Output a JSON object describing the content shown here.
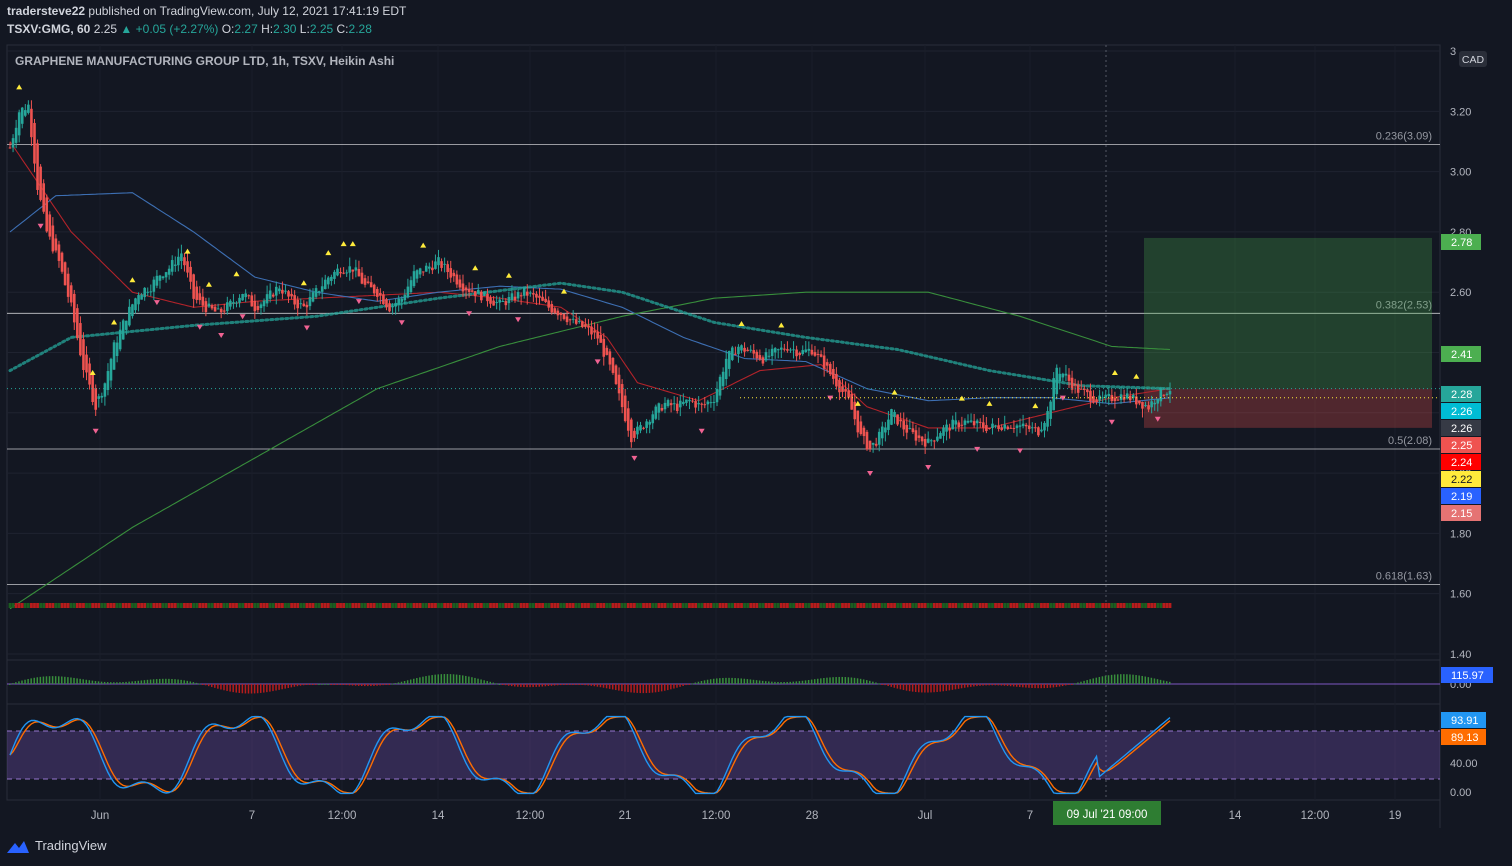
{
  "header": {
    "author": "tradersteve22",
    "published": "published on TradingView.com, July 12, 2021 17:41:19 EDT",
    "symbol": "TSXV:GMG, 60",
    "last": "2.25",
    "change": "+0.05 (+2.27%)",
    "open_label": "O:",
    "open": "2.27",
    "high_label": "H:",
    "high": "2.30",
    "low_label": "L:",
    "low": "2.25",
    "close_label": "C:",
    "close": "2.28"
  },
  "footer": {
    "brand": "TradingView"
  },
  "colors": {
    "bg": "#131722",
    "up": "#26a69a",
    "down": "#ef5350",
    "ema_red": "#b2232a",
    "ema_blue": "#2962ff",
    "ema_green": "#388e3c",
    "teal_dots": "#26a69a",
    "stoch_k": "#2196f3",
    "stoch_d": "#ff6d00",
    "stoch_band": "#7e57c2"
  },
  "chart_data": [
    {
      "type": "line",
      "title": "GRAPHENE MANUFACTURING GROUP LTD, 1h, TSXV, Heikin Ashi",
      "currency": "CAD",
      "y_ticks": [
        "3",
        "3.20",
        "3.00",
        "2.80",
        "2.60",
        "2.40",
        "2.20",
        "2.00",
        "1.80",
        "1.60",
        "1.40"
      ],
      "y_tick_values": [
        3.4,
        3.2,
        3.0,
        2.8,
        2.6,
        2.4,
        2.2,
        2.0,
        1.8,
        1.6,
        1.4
      ],
      "ylim": [
        1.38,
        3.42
      ],
      "x_ticks": [
        "Jun",
        "7",
        "12:00",
        "14",
        "12:00",
        "21",
        "12:00",
        "28",
        "Jul",
        "7",
        "14",
        "12:00",
        "19"
      ],
      "crosshair_label": "09 Jul '21  09:00",
      "fib_levels": [
        {
          "label": "0.236(3.09)",
          "value": 3.09
        },
        {
          "label": "0.382(2.53)",
          "value": 2.53
        },
        {
          "label": "0.5(2.08)",
          "value": 2.08
        },
        {
          "label": "0.618(1.63)",
          "value": 1.63
        }
      ],
      "position": {
        "entry": 2.28,
        "target": 2.78,
        "stop": 2.15
      },
      "price_labels": [
        {
          "text": "2.78",
          "value": 2.78,
          "color": "#4caf50"
        },
        {
          "text": "2.41",
          "value": 2.41,
          "color": "#4caf50"
        },
        {
          "text": "2.28",
          "value": 2.28,
          "color": "#26a69a"
        },
        {
          "text": "2.26",
          "value": 2.26,
          "color": "#00bcd4"
        },
        {
          "text": "2.26",
          "value": 2.26,
          "color": "#363a45"
        },
        {
          "text": "2.25",
          "value": 2.25,
          "color": "#ef5350"
        },
        {
          "text": "2.24",
          "value": 2.24,
          "color": "#ff0000"
        },
        {
          "text": "2.22",
          "value": 2.22,
          "color": "#ffeb3b"
        },
        {
          "text": "2.19",
          "value": 2.19,
          "color": "#2962ff"
        },
        {
          "text": "2.15",
          "value": 2.15,
          "color": "#e57373"
        }
      ],
      "price_keypoints": [
        [
          0,
          3.08
        ],
        [
          3,
          3.2
        ],
        [
          6,
          3.22
        ],
        [
          9,
          2.95
        ],
        [
          12,
          2.8
        ],
        [
          16,
          2.7
        ],
        [
          20,
          2.55
        ],
        [
          24,
          2.35
        ],
        [
          28,
          2.22
        ],
        [
          31,
          2.3
        ],
        [
          34,
          2.42
        ],
        [
          38,
          2.52
        ],
        [
          42,
          2.6
        ],
        [
          46,
          2.62
        ],
        [
          49,
          2.66
        ],
        [
          52,
          2.68
        ],
        [
          56,
          2.73
        ],
        [
          60,
          2.58
        ],
        [
          64,
          2.55
        ],
        [
          68,
          2.53
        ],
        [
          72,
          2.56
        ],
        [
          76,
          2.6
        ],
        [
          80,
          2.55
        ],
        [
          84,
          2.58
        ],
        [
          88,
          2.62
        ],
        [
          92,
          2.57
        ],
        [
          96,
          2.55
        ],
        [
          100,
          2.6
        ],
        [
          104,
          2.65
        ],
        [
          108,
          2.68
        ],
        [
          112,
          2.68
        ],
        [
          116,
          2.62
        ],
        [
          120,
          2.6
        ],
        [
          124,
          2.55
        ],
        [
          128,
          2.58
        ],
        [
          132,
          2.66
        ],
        [
          136,
          2.68
        ],
        [
          140,
          2.7
        ],
        [
          144,
          2.66
        ],
        [
          148,
          2.62
        ],
        [
          152,
          2.6
        ],
        [
          156,
          2.58
        ],
        [
          160,
          2.56
        ],
        [
          164,
          2.58
        ],
        [
          168,
          2.6
        ],
        [
          172,
          2.58
        ],
        [
          176,
          2.55
        ],
        [
          180,
          2.53
        ],
        [
          184,
          2.5
        ],
        [
          188,
          2.48
        ],
        [
          192,
          2.45
        ],
        [
          196,
          2.35
        ],
        [
          200,
          2.22
        ],
        [
          203,
          2.12
        ],
        [
          206,
          2.15
        ],
        [
          210,
          2.2
        ],
        [
          214,
          2.23
        ],
        [
          218,
          2.22
        ],
        [
          222,
          2.24
        ],
        [
          226,
          2.22
        ],
        [
          230,
          2.25
        ],
        [
          234,
          2.38
        ],
        [
          238,
          2.42
        ],
        [
          242,
          2.4
        ],
        [
          246,
          2.38
        ],
        [
          250,
          2.4
        ],
        [
          254,
          2.42
        ],
        [
          258,
          2.4
        ],
        [
          262,
          2.41
        ],
        [
          266,
          2.36
        ],
        [
          270,
          2.3
        ],
        [
          274,
          2.24
        ],
        [
          278,
          2.12
        ],
        [
          281,
          2.08
        ],
        [
          284,
          2.12
        ],
        [
          288,
          2.2
        ],
        [
          292,
          2.15
        ],
        [
          296,
          2.12
        ],
        [
          300,
          2.1
        ],
        [
          304,
          2.14
        ],
        [
          308,
          2.16
        ],
        [
          312,
          2.17
        ],
        [
          316,
          2.16
        ],
        [
          320,
          2.15
        ],
        [
          324,
          2.16
        ],
        [
          328,
          2.16
        ],
        [
          332,
          2.15
        ],
        [
          336,
          2.14
        ],
        [
          339,
          2.2
        ],
        [
          342,
          2.35
        ],
        [
          345,
          2.32
        ],
        [
          348,
          2.28
        ],
        [
          352,
          2.26
        ],
        [
          356,
          2.24
        ],
        [
          360,
          2.25
        ],
        [
          364,
          2.26
        ],
        [
          368,
          2.24
        ],
        [
          372,
          2.22
        ],
        [
          375,
          2.26
        ],
        [
          379,
          2.28
        ]
      ],
      "series": [
        {
          "name": "",
          "role": "ema_fast",
          "values": [
            [
              0,
              3.1
            ],
            [
              20,
              2.8
            ],
            [
              40,
              2.6
            ],
            [
              60,
              2.55
            ],
            [
              80,
              2.57
            ],
            [
              100,
              2.58
            ],
            [
              120,
              2.59
            ],
            [
              140,
              2.6
            ],
            [
              160,
              2.58
            ],
            [
              180,
              2.55
            ],
            [
              195,
              2.45
            ],
            [
              205,
              2.3
            ],
            [
              225,
              2.24
            ],
            [
              245,
              2.34
            ],
            [
              265,
              2.36
            ],
            [
              280,
              2.22
            ],
            [
              300,
              2.15
            ],
            [
              320,
              2.15
            ],
            [
              340,
              2.2
            ],
            [
              360,
              2.25
            ],
            [
              379,
              2.28
            ]
          ]
        },
        {
          "name": "",
          "role": "ema_mid",
          "values": [
            [
              0,
              2.8
            ],
            [
              15,
              2.92
            ],
            [
              40,
              2.93
            ],
            [
              60,
              2.8
            ],
            [
              80,
              2.65
            ],
            [
              100,
              2.6
            ],
            [
              120,
              2.57
            ],
            [
              140,
              2.6
            ],
            [
              160,
              2.62
            ],
            [
              180,
              2.61
            ],
            [
              200,
              2.55
            ],
            [
              220,
              2.45
            ],
            [
              240,
              2.38
            ],
            [
              260,
              2.37
            ],
            [
              280,
              2.28
            ],
            [
              300,
              2.24
            ],
            [
              320,
              2.25
            ],
            [
              340,
              2.25
            ],
            [
              360,
              2.23
            ],
            [
              379,
              2.25
            ]
          ]
        },
        {
          "name": "",
          "role": "ema_slow",
          "values": [
            [
              0,
              1.55
            ],
            [
              40,
              1.82
            ],
            [
              80,
              2.05
            ],
            [
              120,
              2.28
            ],
            [
              160,
              2.42
            ],
            [
              200,
              2.52
            ],
            [
              230,
              2.58
            ],
            [
              260,
              2.6
            ],
            [
              300,
              2.6
            ],
            [
              330,
              2.52
            ],
            [
              360,
              2.42
            ],
            [
              379,
              2.41
            ]
          ]
        },
        {
          "name": "",
          "role": "dotted_ma",
          "values": [
            [
              0,
              2.34
            ],
            [
              20,
              2.45
            ],
            [
              60,
              2.49
            ],
            [
              100,
              2.52
            ],
            [
              140,
              2.58
            ],
            [
              180,
              2.63
            ],
            [
              200,
              2.6
            ],
            [
              230,
              2.5
            ],
            [
              260,
              2.45
            ],
            [
              290,
              2.41
            ],
            [
              320,
              2.34
            ],
            [
              350,
              2.29
            ],
            [
              379,
              2.28
            ]
          ]
        }
      ]
    },
    {
      "type": "bar",
      "title": "",
      "last_value": "115.97",
      "zero_label": "0.00"
    },
    {
      "type": "line",
      "title": "",
      "y_ticks": [
        "40.00",
        "0.00"
      ],
      "ylim": [
        0,
        100
      ],
      "band": [
        20,
        80
      ],
      "series": [
        {
          "name": "",
          "last_value": "93.91",
          "color": "#2196f3"
        },
        {
          "name": "",
          "last_value": "89.13",
          "color": "#ff6d00"
        }
      ]
    }
  ]
}
